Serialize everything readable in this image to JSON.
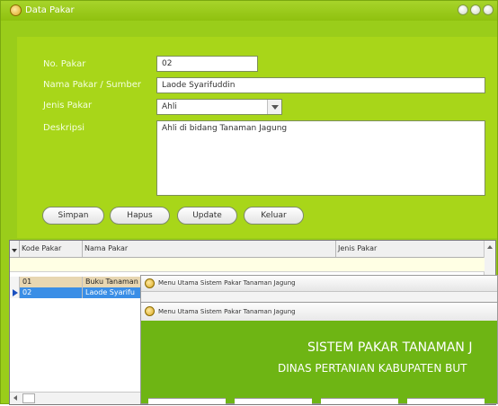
{
  "window": {
    "title": "Data Pakar"
  },
  "form": {
    "no_pakar_label": "No. Pakar",
    "no_pakar_value": "02",
    "nama_label": "Nama Pakar / Sumber",
    "nama_value": "Laode Syarifuddin",
    "jenis_label": "Jenis Pakar",
    "jenis_value": "Ahli",
    "deskripsi_label": "Deskripsi",
    "deskripsi_value": "Ahli di bidang Tanaman Jagung"
  },
  "buttons": {
    "simpan": "Simpan",
    "hapus": "Hapus",
    "update": "Update",
    "keluar": "Keluar"
  },
  "grid": {
    "columns": [
      "Kode Pakar",
      "Nama Pakar",
      "Jenis Pakar"
    ],
    "rows": [
      {
        "kode": "01",
        "nama": "Buku Tanaman"
      },
      {
        "kode": "02",
        "nama": "Laode Syarifu"
      }
    ]
  },
  "menu_back": {
    "title": "Menu Utama Sistem Pakar Tanaman Jagung"
  },
  "menu_front": {
    "title": "Menu Utama Sistem Pakar Tanaman Jagung",
    "heading": "SISTEM PAKAR TANAMAN J",
    "subheading": "DINAS PERTANIAN KABUPATEN BUT"
  },
  "colors": {
    "window_bg": "#9acd1a",
    "selected_row": "#3a8ee6",
    "highlight_row": "#e8d7b2"
  }
}
